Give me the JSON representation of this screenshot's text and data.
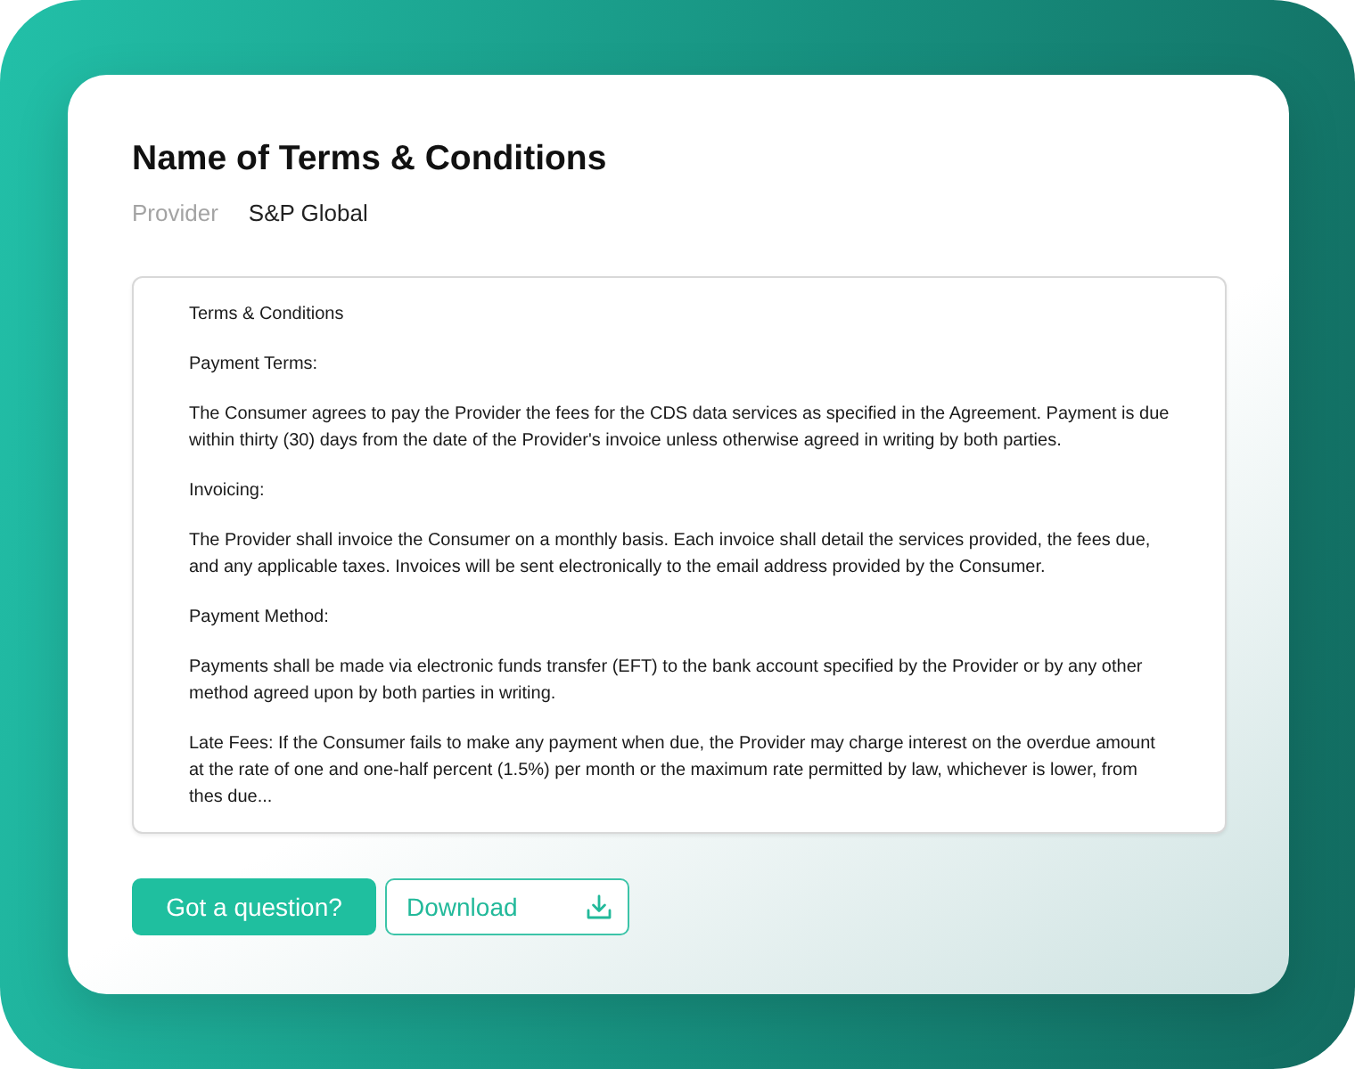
{
  "card": {
    "title": "Name of Terms & Conditions",
    "provider": {
      "label": "Provider",
      "value": "S&P Global"
    }
  },
  "terms_box": {
    "paragraphs": [
      "Terms & Conditions",
      "Payment Terms:",
      "The Consumer agrees to pay the Provider the fees for the CDS data services as specified in the Agreement. Payment is due within thirty (30) days from the date of the Provider's invoice unless otherwise agreed in writing by both parties.",
      "Invoicing:",
      "The Provider shall invoice the Consumer on a monthly basis. Each invoice shall detail the services provided, the fees due, and any applicable taxes. Invoices will be sent electronically to the email address provided by the Consumer.",
      "Payment Method:",
      "Payments shall be made via electronic funds transfer (EFT) to the bank account specified by the Provider or by any other method agreed upon by both parties in writing.",
      "Late Fees: If the Consumer fails to make any payment when due, the Provider may charge interest on the overdue amount at the rate of one and one-half percent (1.5%) per month or the maximum rate permitted by law, whichever is lower, from thes due..."
    ]
  },
  "buttons": [
    {
      "label": "Got a question?",
      "kind": "primary"
    },
    {
      "label": "Download",
      "kind": "download"
    }
  ]
}
